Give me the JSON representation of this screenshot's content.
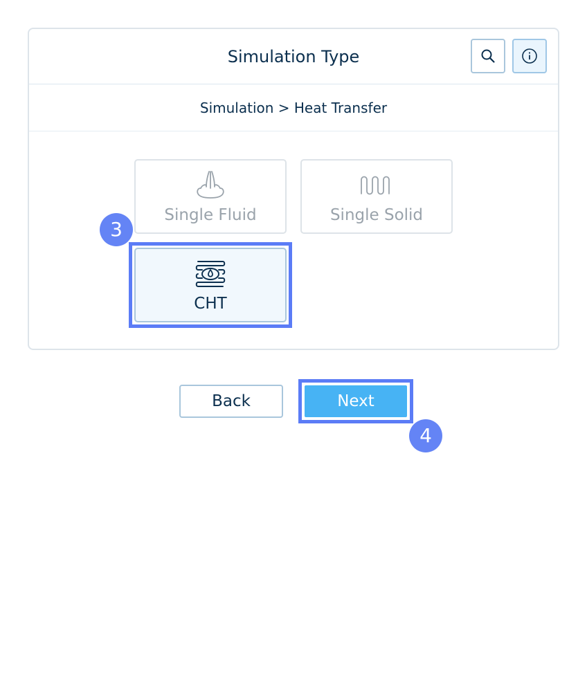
{
  "header": {
    "title": "Simulation Type",
    "search_icon": "search-icon",
    "info_icon": "info-icon"
  },
  "breadcrumb": "Simulation > Heat Transfer",
  "options": [
    {
      "label": "Single Fluid",
      "icon": "fluid-icon",
      "state": "disabled"
    },
    {
      "label": "Single Solid",
      "icon": "solid-icon",
      "state": "disabled"
    },
    {
      "label": "CHT",
      "icon": "cht-icon",
      "state": "selected"
    }
  ],
  "steps": {
    "cht_step": "3",
    "next_step": "4"
  },
  "footer": {
    "back_label": "Back",
    "next_label": "Next"
  },
  "colors": {
    "primary_text": "#0b2f4e",
    "accent": "#47b3f4",
    "highlight": "#5b7cf6",
    "disabled_text": "#9aa3ab"
  }
}
